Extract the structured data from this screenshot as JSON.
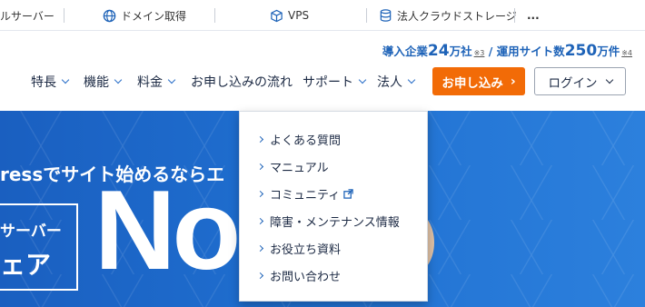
{
  "topbar": {
    "items": [
      {
        "label": "ルサーバー",
        "icon": "server-icon"
      },
      {
        "label": "ドメイン取得",
        "icon": "globe-icon"
      },
      {
        "label": "VPS",
        "icon": "cube-icon"
      },
      {
        "label": "法人クラウドストレージ",
        "icon": "database-icon"
      },
      {
        "label": "...",
        "icon": "more-icon"
      }
    ]
  },
  "stats": {
    "prefix1": "導入企業",
    "num1": "24",
    "unit1": "万社",
    "note1": "※3",
    "sep": " / ",
    "prefix2": "運用サイト数",
    "num2": "250",
    "unit2": "万件",
    "note2": "※4"
  },
  "nav": {
    "items": [
      {
        "label": "特長"
      },
      {
        "label": "機能"
      },
      {
        "label": "料金"
      },
      {
        "label": "お申し込みの流れ"
      },
      {
        "label": "サポート"
      },
      {
        "label": "法人"
      }
    ],
    "apply_label": "お申し込み",
    "apply_arrow": "›",
    "login_label": "ログイン"
  },
  "hero": {
    "tagline": "ressでサイト始めるならエ",
    "box_line1": "サーバー",
    "box_line2": "ェア",
    "big_text": "No"
  },
  "dropdown": {
    "items": [
      {
        "label": "よくある質問",
        "external": false
      },
      {
        "label": "マニュアル",
        "external": false
      },
      {
        "label": "コミュニティ",
        "external": true
      },
      {
        "label": "障害・メンテナンス情報",
        "external": false
      },
      {
        "label": "お役立ち資料",
        "external": false
      },
      {
        "label": "お問い合わせ",
        "external": false
      }
    ]
  },
  "colors": {
    "accent": "#1e63b8",
    "apply": "#f26b07",
    "hero": "#1f6fd0"
  }
}
